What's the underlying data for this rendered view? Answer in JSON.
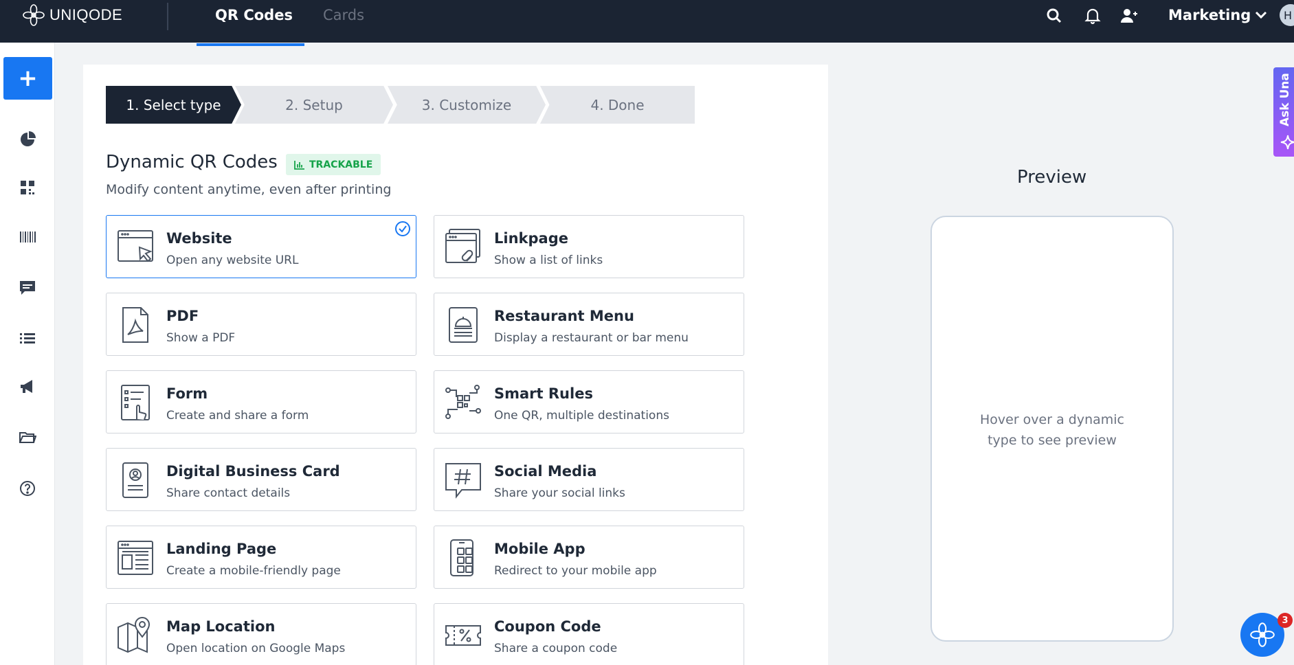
{
  "brand": {
    "name": "UNIQODE"
  },
  "nav": {
    "tab_qr": "QR Codes",
    "tab_cards": "Cards",
    "workspace": "Marketing",
    "avatar_initial": "H"
  },
  "sidebar": {
    "create_label": "+"
  },
  "stepper": {
    "steps": [
      "1. Select type",
      "2. Setup",
      "3. Customize",
      "4. Done"
    ]
  },
  "section": {
    "title": "Dynamic QR Codes",
    "badge": "TRACKABLE",
    "subtitle": "Modify content anytime, even after printing"
  },
  "cards": [
    {
      "title": "Website",
      "desc": "Open any website URL",
      "icon": "website-icon",
      "selected": true
    },
    {
      "title": "Linkpage",
      "desc": "Show a list of links",
      "icon": "linkpage-icon"
    },
    {
      "title": "PDF",
      "desc": "Show a PDF",
      "icon": "pdf-icon"
    },
    {
      "title": "Restaurant Menu",
      "desc": "Display a restaurant or bar menu",
      "icon": "restaurant-menu-icon"
    },
    {
      "title": "Form",
      "desc": "Create and share a form",
      "icon": "form-icon"
    },
    {
      "title": "Smart Rules",
      "desc": "One QR, multiple destinations",
      "icon": "smart-rules-icon"
    },
    {
      "title": "Digital Business Card",
      "desc": "Share contact details",
      "icon": "business-card-icon"
    },
    {
      "title": "Social Media",
      "desc": "Share your social links",
      "icon": "social-media-icon"
    },
    {
      "title": "Landing Page",
      "desc": "Create a mobile-friendly page",
      "icon": "landing-page-icon"
    },
    {
      "title": "Mobile App",
      "desc": "Redirect to your mobile app",
      "icon": "mobile-app-icon"
    },
    {
      "title": "Map Location",
      "desc": "Open location on Google Maps",
      "icon": "map-location-icon"
    },
    {
      "title": "Coupon Code",
      "desc": "Share a coupon code",
      "icon": "coupon-code-icon"
    }
  ],
  "preview": {
    "title": "Preview",
    "hint_line1": "Hover over a dynamic",
    "hint_line2": "type to see preview"
  },
  "ask_una": {
    "label": "Ask Una"
  },
  "chat": {
    "badge_count": "3"
  },
  "colors": {
    "topbar": "#1b2433",
    "accent": "#1877f2",
    "trackable_green": "#16a34a"
  }
}
